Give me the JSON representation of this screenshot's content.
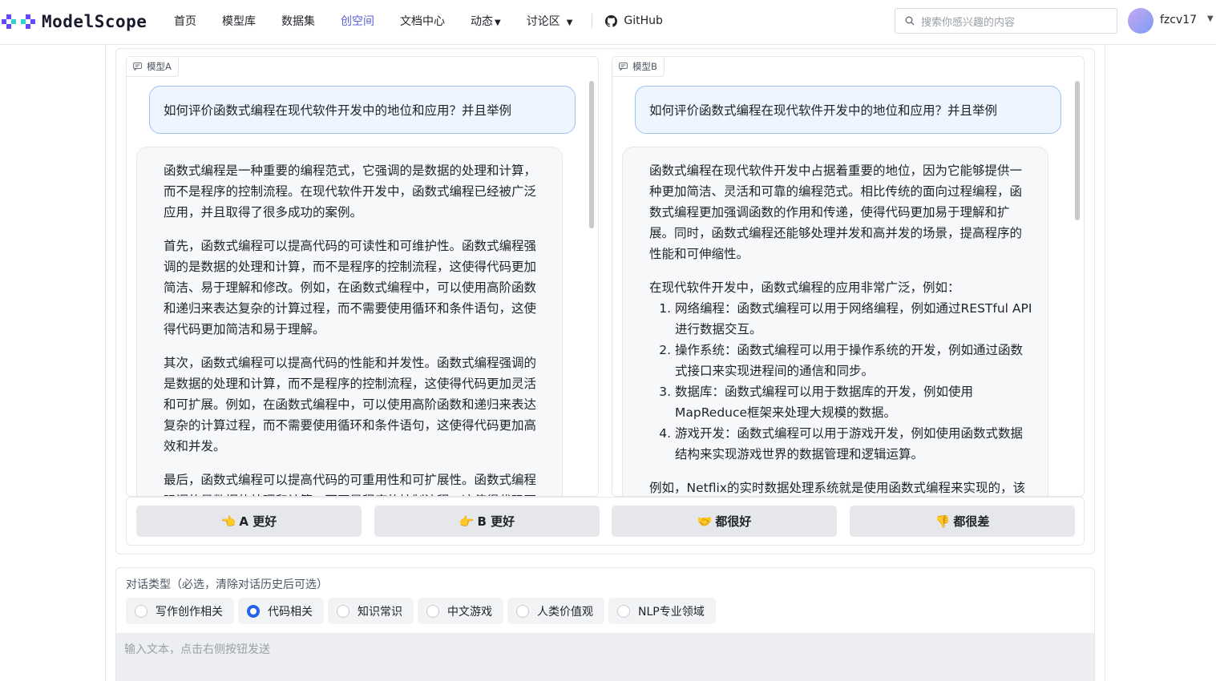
{
  "header": {
    "logo_text": "ModelScope",
    "nav": [
      {
        "label": "首页"
      },
      {
        "label": "模型库"
      },
      {
        "label": "数据集"
      },
      {
        "label": "创空间"
      },
      {
        "label": "文档中心"
      },
      {
        "label": "动态"
      },
      {
        "label": "讨论区"
      }
    ],
    "github_label": "GitHub",
    "search_placeholder": "搜索你感兴趣的内容",
    "username": "fzcv17",
    "active_color": "#5b5fd6"
  },
  "panels": {
    "a": {
      "label": "模型A",
      "question": "如何评价函数式编程在现代软件开发中的地位和应用？并且举例",
      "paragraphs": [
        "函数式编程是一种重要的编程范式，它强调的是数据的处理和计算，而不是程序的控制流程。在现代软件开发中，函数式编程已经被广泛应用，并且取得了很多成功的案例。",
        "首先，函数式编程可以提高代码的可读性和可维护性。函数式编程强调的是数据的处理和计算，而不是程序的控制流程，这使得代码更加简洁、易于理解和修改。例如，在函数式编程中，可以使用高阶函数和递归来表达复杂的计算过程，而不需要使用循环和条件语句，这使得代码更加简洁和易于理解。",
        "其次，函数式编程可以提高代码的性能和并发性。函数式编程强调的是数据的处理和计算，而不是程序的控制流程，这使得代码更加灵活和可扩展。例如，在函数式编程中，可以使用高阶函数和递归来表达复杂的计算过程，而不需要使用循环和条件语句，这使得代码更加高效和并发。",
        "最后，函数式编程可以提高代码的可重用性和可扩展性。函数式编程强调的是数据的处理和计算，而不是程序的控制流程，这使得代码更加可重用"
      ]
    },
    "b": {
      "label": "模型B",
      "question": "如何评价函数式编程在现代软件开发中的地位和应用？并且举例",
      "intro": "函数式编程在现代软件开发中占据着重要的地位，因为它能够提供一种更加简洁、灵活和可靠的编程范式。相比传统的面向过程编程，函数式编程更加强调函数的作用和传递，使得代码更加易于理解和扩展。同时，函数式编程还能够处理并发和高并发的场景，提高程序的性能和可伸缩性。",
      "list_intro": "在现代软件开发中，函数式编程的应用非常广泛，例如：",
      "items": [
        "网络编程：函数式编程可以用于网络编程，例如通过RESTful API进行数据交互。",
        "操作系统：函数式编程可以用于操作系统的开发，例如通过函数式接口来实现进程间的通信和同步。",
        "数据库：函数式编程可以用于数据库的开发，例如使用MapReduce框架来处理大规模的数据。",
        "游戏开发：函数式编程可以用于游戏开发，例如使用函数式数据结构来实现游戏世界的数据管理和逻辑运算。"
      ],
      "outro": "例如，Netflix的实时数据处理系统就是使用函数式编程来实现的，该系统可以处理海量的数据"
    }
  },
  "votes": [
    {
      "emoji": "👈",
      "label": "A 更好"
    },
    {
      "emoji": "👉",
      "label": "B 更好"
    },
    {
      "emoji": "🤝",
      "label": "都很好"
    },
    {
      "emoji": "👎",
      "label": "都很差"
    }
  ],
  "dialog_type": {
    "label": "对话类型（必选，清除对话历史后可选）",
    "options": [
      "写作创作相关",
      "代码相关",
      "知识常识",
      "中文游戏",
      "人类价值观",
      "NLP专业领域"
    ],
    "selected": "代码相关"
  },
  "input": {
    "placeholder": "输入文本，点击右侧按钮发送"
  }
}
